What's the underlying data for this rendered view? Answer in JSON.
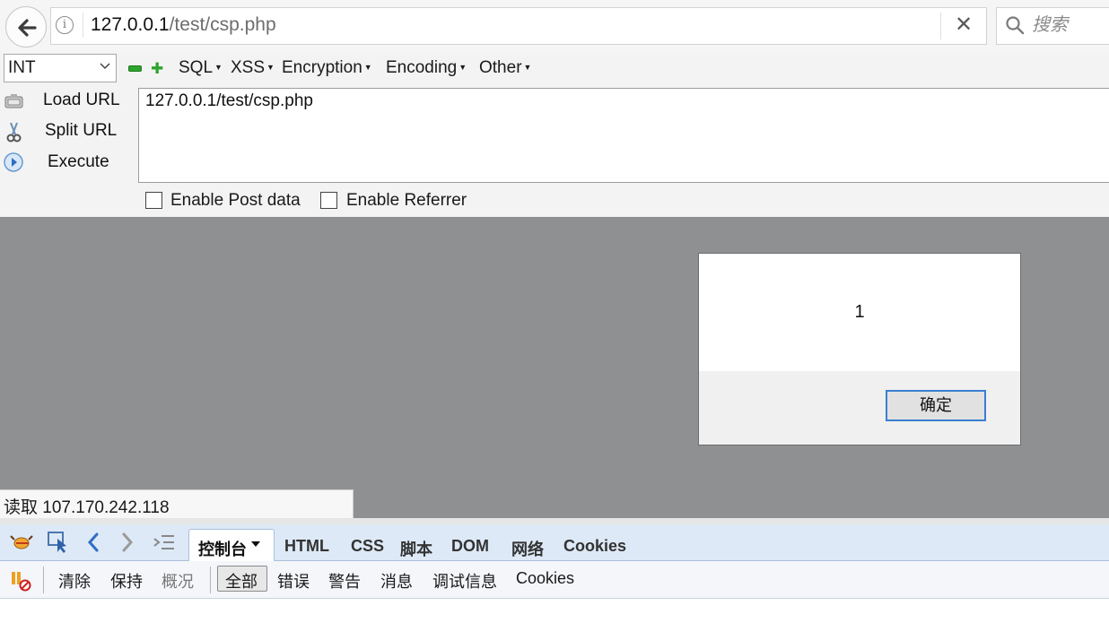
{
  "browser": {
    "url_host": "127.0.0.1",
    "url_path": "/test/csp.php",
    "search_placeholder": "搜索"
  },
  "hackbar": {
    "type_select": "INT",
    "menus": [
      "SQL",
      "XSS",
      "Encryption",
      "Encoding",
      "Other"
    ],
    "load_url": "Load URL",
    "split_url": "Split URL",
    "execute": "Execute",
    "url_value": "127.0.0.1/test/csp.php",
    "enable_post": "Enable Post data",
    "enable_referrer": "Enable Referrer"
  },
  "dialog": {
    "message": "1",
    "ok_label": "确定"
  },
  "status": {
    "text": "读取 107.170.242.118"
  },
  "firebug": {
    "tabs": {
      "console": "控制台",
      "html": "HTML",
      "css": "CSS",
      "script": "脚本",
      "dom": "DOM",
      "net": "网络",
      "cookies": "Cookies"
    },
    "toolbar": {
      "clear": "清除",
      "persist": "保持",
      "profile": "概况",
      "all": "全部",
      "errors": "错误",
      "warnings": "警告",
      "info": "消息",
      "debug": "调试信息",
      "cookies": "Cookies"
    }
  },
  "colors": {
    "content_bg": "#8f9092",
    "accent": "#3a7fd0",
    "firebug_tab_bg": "#dde9f6"
  }
}
